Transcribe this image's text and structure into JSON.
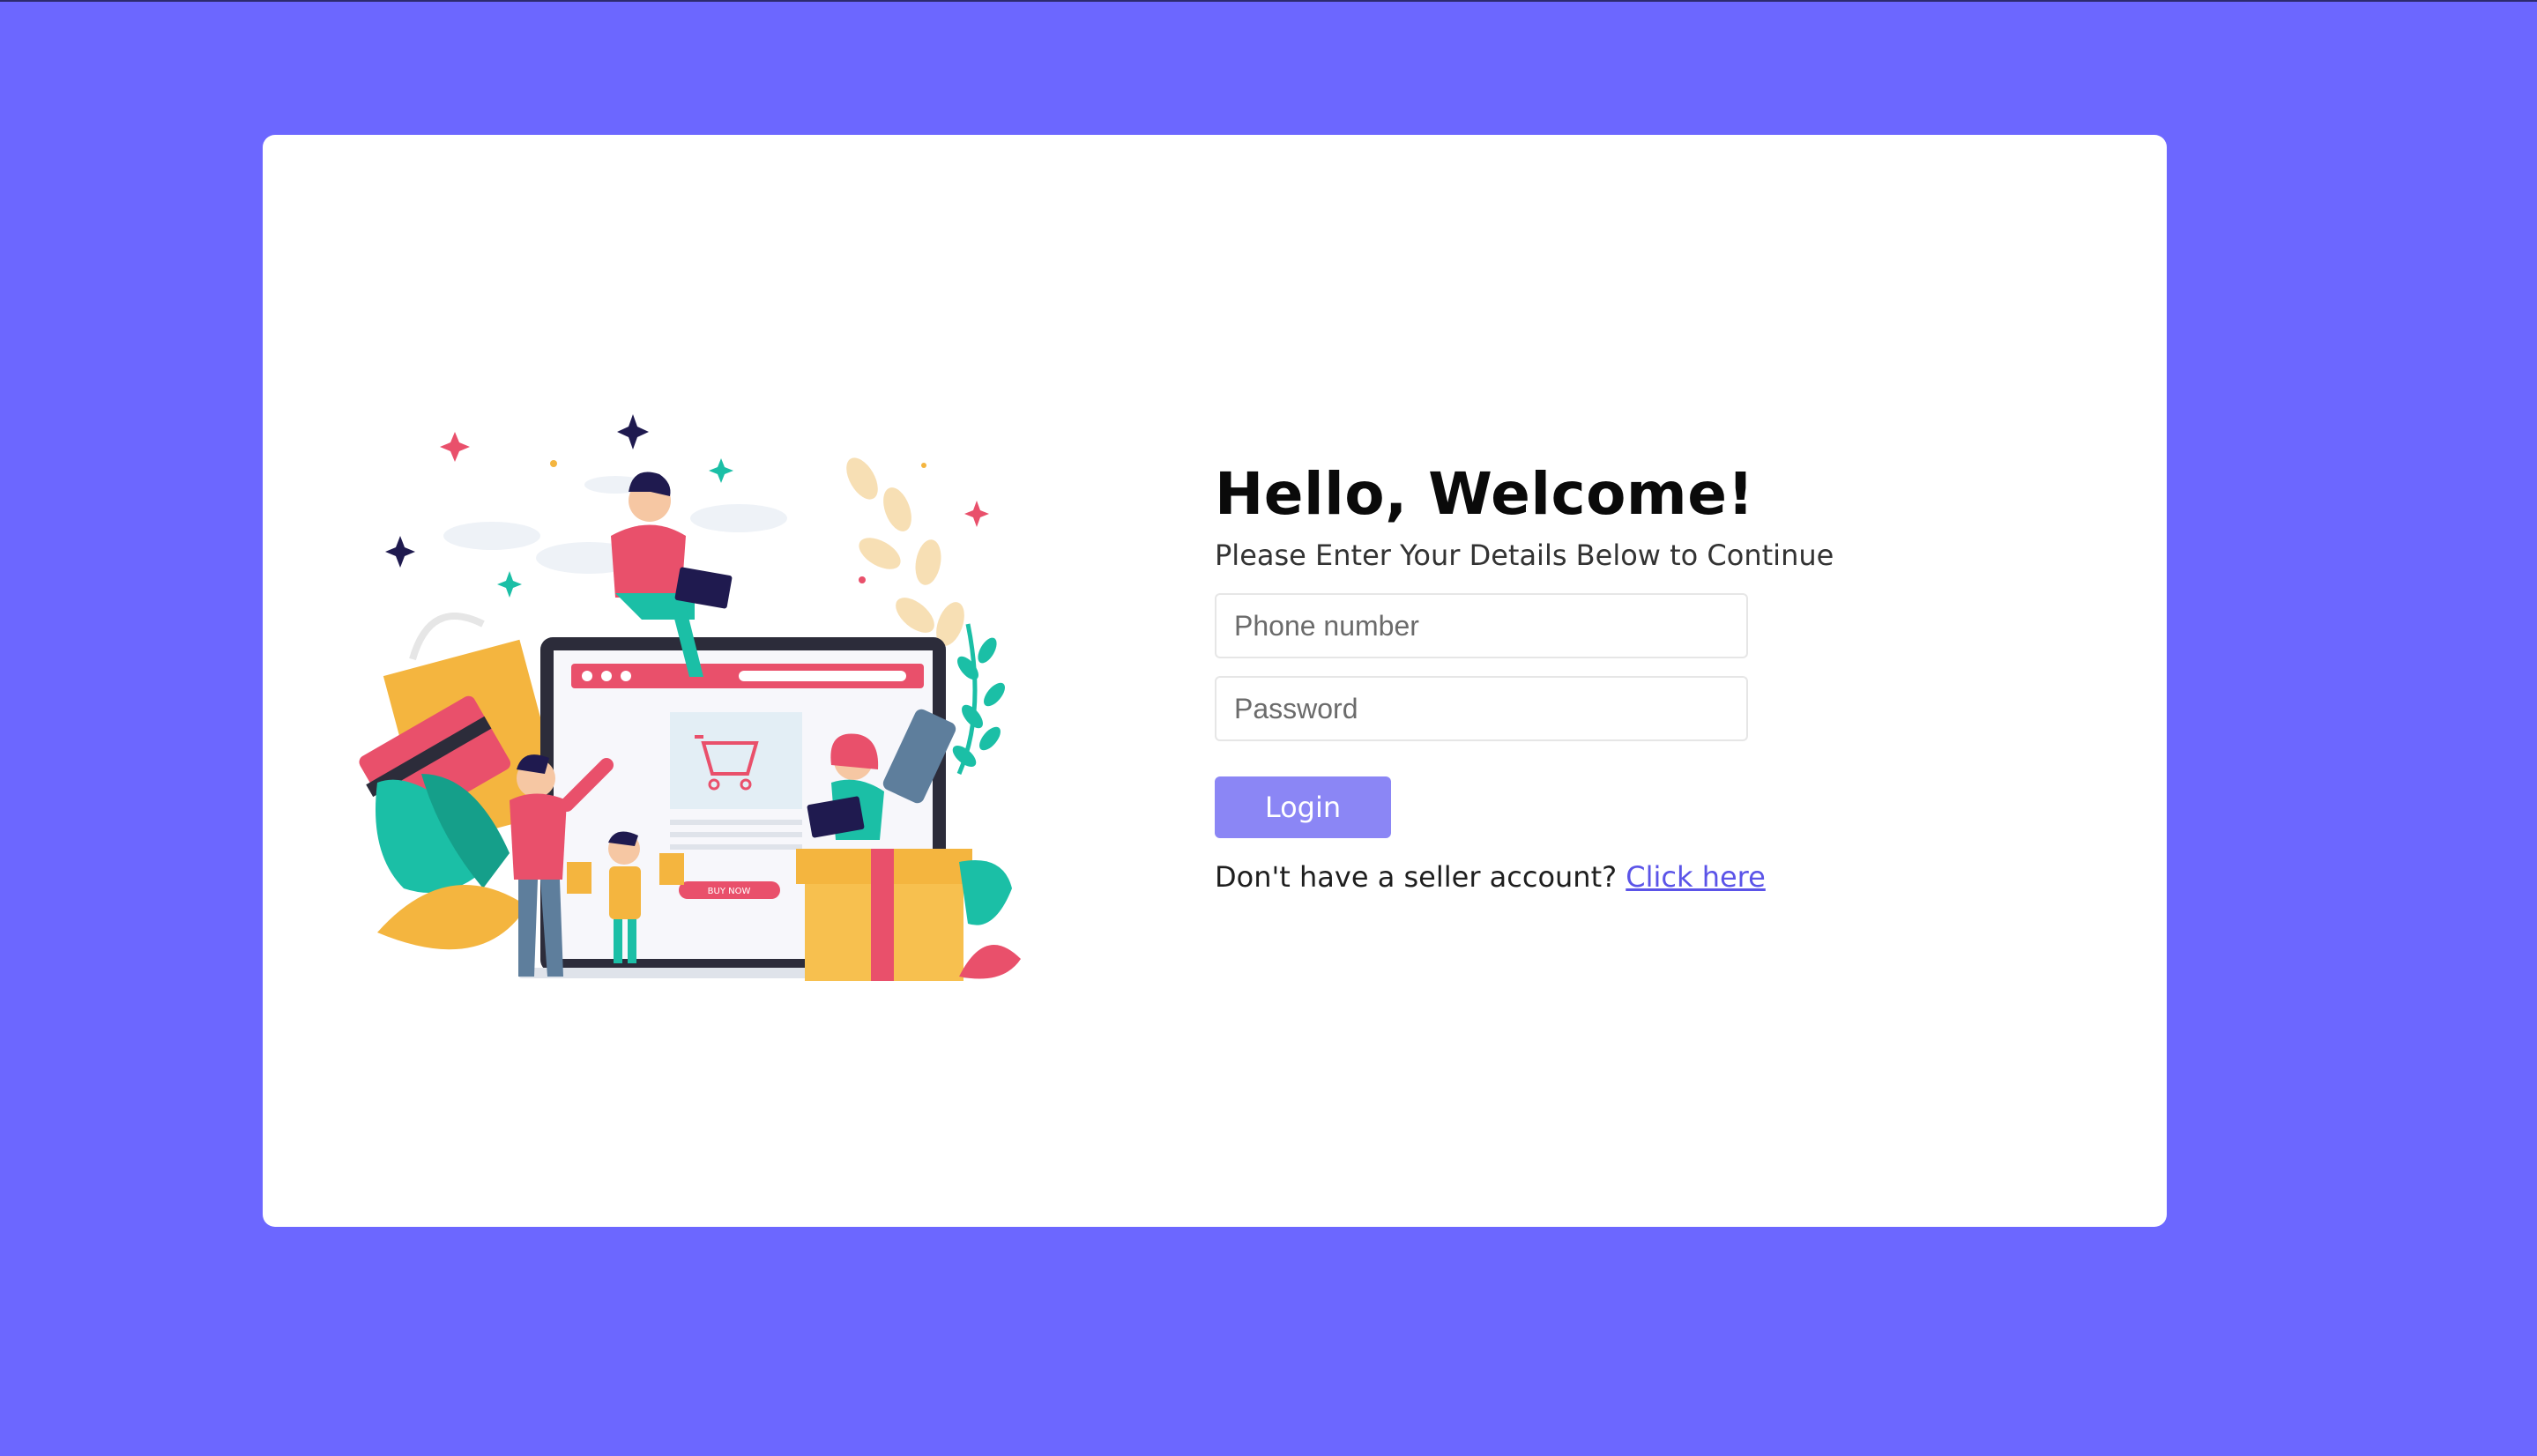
{
  "colors": {
    "background": "#6c67ff",
    "card": "#ffffff",
    "accent": "#8b86f5",
    "link": "#5b54e8"
  },
  "illustration": {
    "icon": "online-shopping-illustration",
    "button_text": "BUY NOW"
  },
  "login": {
    "title": "Hello, Welcome!",
    "subtitle": "Please Enter Your Details Below to Continue",
    "phone_placeholder": "Phone number",
    "password_placeholder": "Password",
    "button_label": "Login",
    "signup_prompt": "Don't have a seller account?",
    "signup_link": "Click here"
  }
}
